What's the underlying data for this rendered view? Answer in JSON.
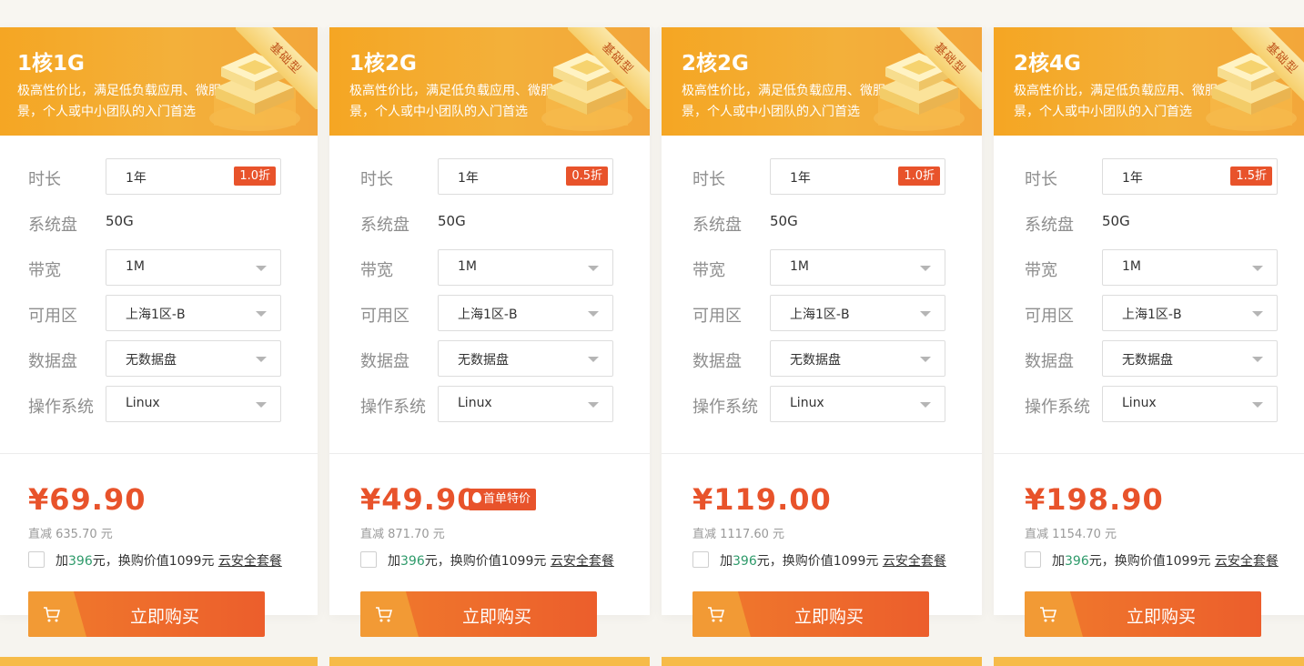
{
  "colors": {
    "accent": "#e8532b",
    "header": "#f5a623",
    "green": "#2e9a6a"
  },
  "labels": {
    "duration": "时长",
    "system_disk": "系统盘",
    "bandwidth": "带宽",
    "zone": "可用区",
    "data_disk": "数据盘",
    "os": "操作系统"
  },
  "cards": [
    {
      "title": "1核1G",
      "badge_type": "基础型",
      "desc": "极高性价比，满足低负载应用、微服务等业务场景，个人或中小团队的入门首选",
      "duration": "1年",
      "discount": "1.0折",
      "system_disk": "50G",
      "bandwidth": "1M",
      "zone": "上海1区-B",
      "data_disk": "无数据盘",
      "os": "Linux",
      "price": "¥69.90",
      "special": "",
      "saving": "直减 635.70 元",
      "addon_prefix": "加",
      "addon_amount": "396",
      "addon_mid": "元，换购价值1099元",
      "addon_link": "云安全套餐",
      "buy": "立即购买"
    },
    {
      "title": "1核2G",
      "badge_type": "基础型",
      "desc": "极高性价比，满足低负载应用、微服务等业务场景，个人或中小团队的入门首选",
      "duration": "1年",
      "discount": "0.5折",
      "system_disk": "50G",
      "bandwidth": "1M",
      "zone": "上海1区-B",
      "data_disk": "无数据盘",
      "os": "Linux",
      "price": "¥49.90",
      "special": "首单特价",
      "saving": "直减 871.70 元",
      "addon_prefix": "加",
      "addon_amount": "396",
      "addon_mid": "元，换购价值1099元",
      "addon_link": "云安全套餐",
      "buy": "立即购买"
    },
    {
      "title": "2核2G",
      "badge_type": "基础型",
      "desc": "极高性价比，满足低负载应用、微服务等业务场景，个人或中小团队的入门首选",
      "duration": "1年",
      "discount": "1.0折",
      "system_disk": "50G",
      "bandwidth": "1M",
      "zone": "上海1区-B",
      "data_disk": "无数据盘",
      "os": "Linux",
      "price": "¥119.00",
      "special": "",
      "saving": "直减 1117.60 元",
      "addon_prefix": "加",
      "addon_amount": "396",
      "addon_mid": "元，换购价值1099元",
      "addon_link": "云安全套餐",
      "buy": "立即购买"
    },
    {
      "title": "2核4G",
      "badge_type": "基础型",
      "desc": "极高性价比，满足低负载应用、微服务等业务场景，个人或中小团队的入门首选",
      "duration": "1年",
      "discount": "1.5折",
      "system_disk": "50G",
      "bandwidth": "1M",
      "zone": "上海1区-B",
      "data_disk": "无数据盘",
      "os": "Linux",
      "price": "¥198.90",
      "special": "",
      "saving": "直减 1154.70 元",
      "addon_prefix": "加",
      "addon_amount": "396",
      "addon_mid": "元，换购价值1099元",
      "addon_link": "云安全套餐",
      "buy": "立即购买"
    }
  ]
}
